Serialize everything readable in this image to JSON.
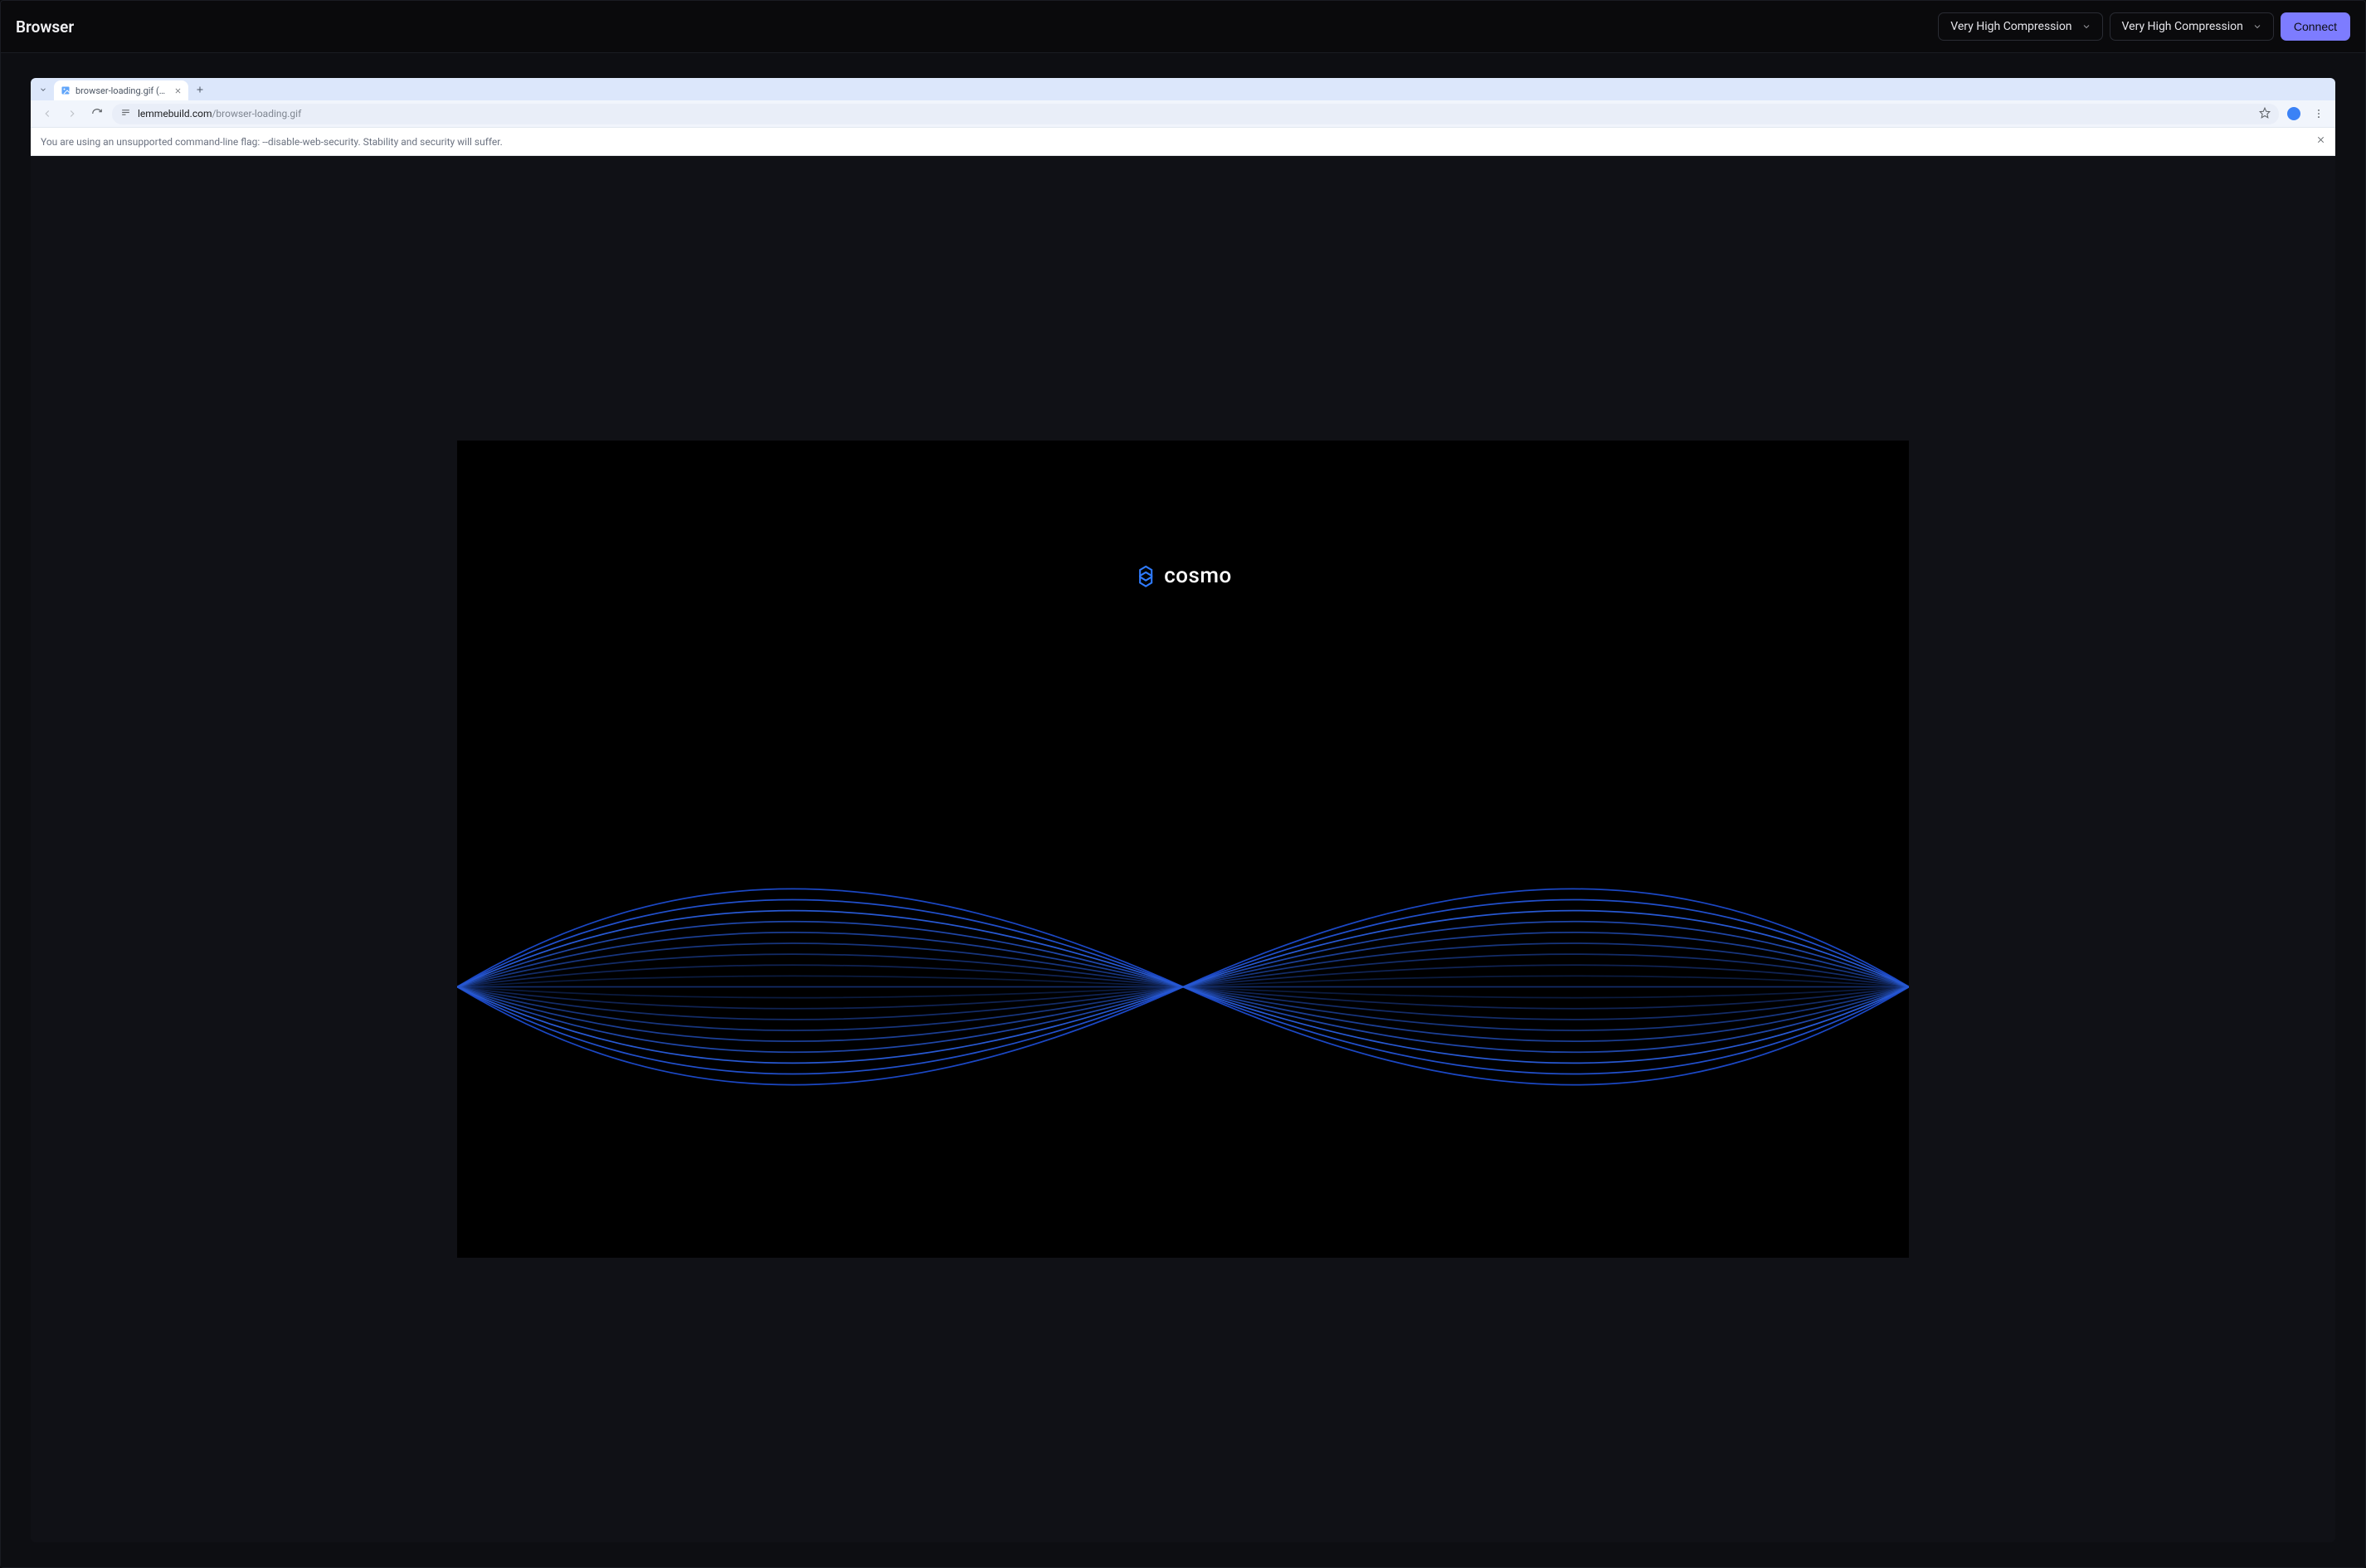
{
  "app": {
    "title": "Browser",
    "compression_select_1": "Very High Compression",
    "compression_select_2": "Very High Compression",
    "connect_label": "Connect"
  },
  "chrome": {
    "tab": {
      "title": "browser-loading.gif (128…"
    },
    "omnibox": {
      "domain": "lemmebuild.com",
      "path": "/browser-loading.gif"
    },
    "infobar": {
      "message": "You are using an unsupported command-line flag: --disable-web-security. Stability and security will suffer."
    }
  },
  "page": {
    "logo_text": "cosmo"
  }
}
